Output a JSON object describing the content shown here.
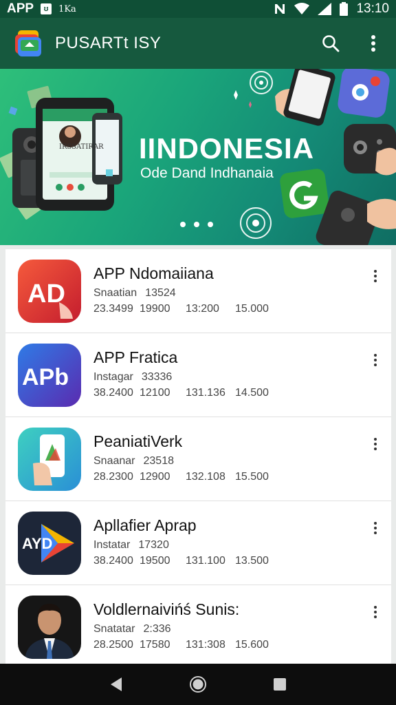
{
  "status": {
    "app_label": "APP",
    "box_glyph": "ʊ",
    "extra": "1Ka",
    "time": "13:10"
  },
  "app_bar": {
    "title": "PUSARTt ISY",
    "icons": [
      "app-logo-icon",
      "search-icon",
      "more-vert-icon"
    ]
  },
  "banner": {
    "title": "IINDONESIA",
    "subtitle": "Ode Dand Indhanaia",
    "phone_caption": "IRSSATIRAR"
  },
  "apps": [
    {
      "title": "APP Ndomaiiana",
      "sub_label": "Snaatian",
      "sub_value": "13524",
      "stats": [
        "23.3499",
        "19900",
        "13:200",
        "15.000"
      ],
      "icon": "ad-icon",
      "icon_text": "AD"
    },
    {
      "title": "APP Fratica",
      "sub_label": "Instagar",
      "sub_value": "33336",
      "stats": [
        "38.2400",
        "12100",
        "131.136",
        "14.500"
      ],
      "icon": "apb-icon",
      "icon_text": "APb"
    },
    {
      "title": "PeaniatiVerk",
      "sub_label": "Snaanar",
      "sub_value": "23518",
      "stats": [
        "28.2300",
        "12900",
        "132.108",
        "15.500"
      ],
      "icon": "hand-phone-icon",
      "icon_text": ""
    },
    {
      "title": "Apllafier Aprap",
      "sub_label": "Instatar",
      "sub_value": "17320",
      "stats": [
        "38.2400",
        "19500",
        "131.100",
        "13.500"
      ],
      "icon": "play-icon",
      "icon_text": "AYD"
    },
    {
      "title": "Voldlernaivińś Sunis:",
      "sub_label": "Snatatar",
      "sub_value": "2:336",
      "stats": [
        "28.2500",
        "17580",
        "131:308",
        "15.600"
      ],
      "icon": "person-photo-icon",
      "icon_text": ""
    }
  ],
  "colors": {
    "status_bar": "#0f4f36",
    "app_bar": "#16593e",
    "banner_start": "#2ebf7a",
    "banner_end": "#0f6d62"
  }
}
